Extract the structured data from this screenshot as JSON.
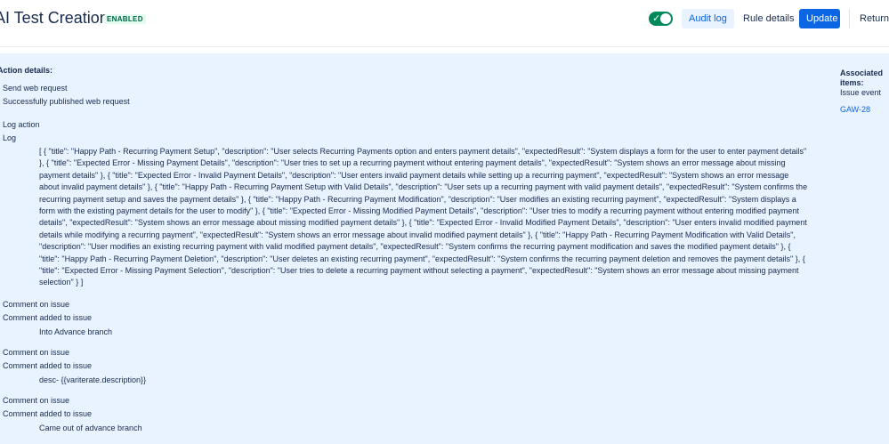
{
  "header": {
    "title": "AI Test Creation",
    "status": "ENABLED",
    "audit_log_label": "Audit log",
    "rule_details_label": "Rule details",
    "update_label": "Update",
    "return_label": "Return to list"
  },
  "panel": {
    "title": "Action details:",
    "entries": [
      {
        "action": "Send web request",
        "detail": "Successfully published web request"
      },
      {
        "action": "Log action",
        "detail": "Log",
        "body": "[ { \"title\": \"Happy Path - Recurring Payment Setup\", \"description\": \"User selects Recurring Payments option and enters payment details\", \"expectedResult\": \"System displays a form for the user to enter payment details\" }, { \"title\": \"Expected Error - Missing Payment Details\", \"description\": \"User tries to set up a recurring payment without entering payment details\", \"expectedResult\": \"System shows an error message about missing payment details\" }, { \"title\": \"Expected Error - Invalid Payment Details\", \"description\": \"User enters invalid payment details while setting up a recurring payment\", \"expectedResult\": \"System shows an error message about invalid payment details\" }, { \"title\": \"Happy Path - Recurring Payment Setup with Valid Details\", \"description\": \"User sets up a recurring payment with valid payment details\", \"expectedResult\": \"System confirms the recurring payment setup and saves the payment details\" }, { \"title\": \"Happy Path - Recurring Payment Modification\", \"description\": \"User modifies an existing recurring payment\", \"expectedResult\": \"System displays a form with the existing payment details for the user to modify\" }, { \"title\": \"Expected Error - Missing Modified Payment Details\", \"description\": \"User tries to modify a recurring payment without entering modified payment details\", \"expectedResult\": \"System shows an error message about missing modified payment details\" }, { \"title\": \"Expected Error - Invalid Modified Payment Details\", \"description\": \"User enters invalid modified payment details while modifying a recurring payment\", \"expectedResult\": \"System shows an error message about invalid modified payment details\" }, { \"title\": \"Happy Path - Recurring Payment Modification with Valid Details\", \"description\": \"User modifies an existing recurring payment with valid modified payment details\", \"expectedResult\": \"System confirms the recurring payment modification and saves the modified payment details\" }, { \"title\": \"Happy Path - Recurring Payment Deletion\", \"description\": \"User deletes an existing recurring payment\", \"expectedResult\": \"System confirms the recurring payment deletion and removes the payment details\" }, { \"title\": \"Expected Error - Missing Payment Selection\", \"description\": \"User tries to delete a recurring payment without selecting a payment\", \"expectedResult\": \"System shows an error message about missing payment selection\" } ]"
      },
      {
        "action": "Comment on issue",
        "detail": "Comment added to issue",
        "body": "Into Advance branch"
      },
      {
        "action": "Comment on issue",
        "detail": "Comment added to issue",
        "body": "desc- {{variterate.description}}"
      },
      {
        "action": "Comment on issue",
        "detail": "Comment added to issue",
        "body": "Came out of advance branch"
      }
    ]
  },
  "associated": {
    "title": "Associated items:",
    "label": "Issue event",
    "issue_key": "GAW-28"
  },
  "colors": {
    "accent": "#0c66e4",
    "panel_bg": "#e9f2ff",
    "enabled_green": "#00875a"
  },
  "icons": {
    "toggle": "check-icon"
  }
}
